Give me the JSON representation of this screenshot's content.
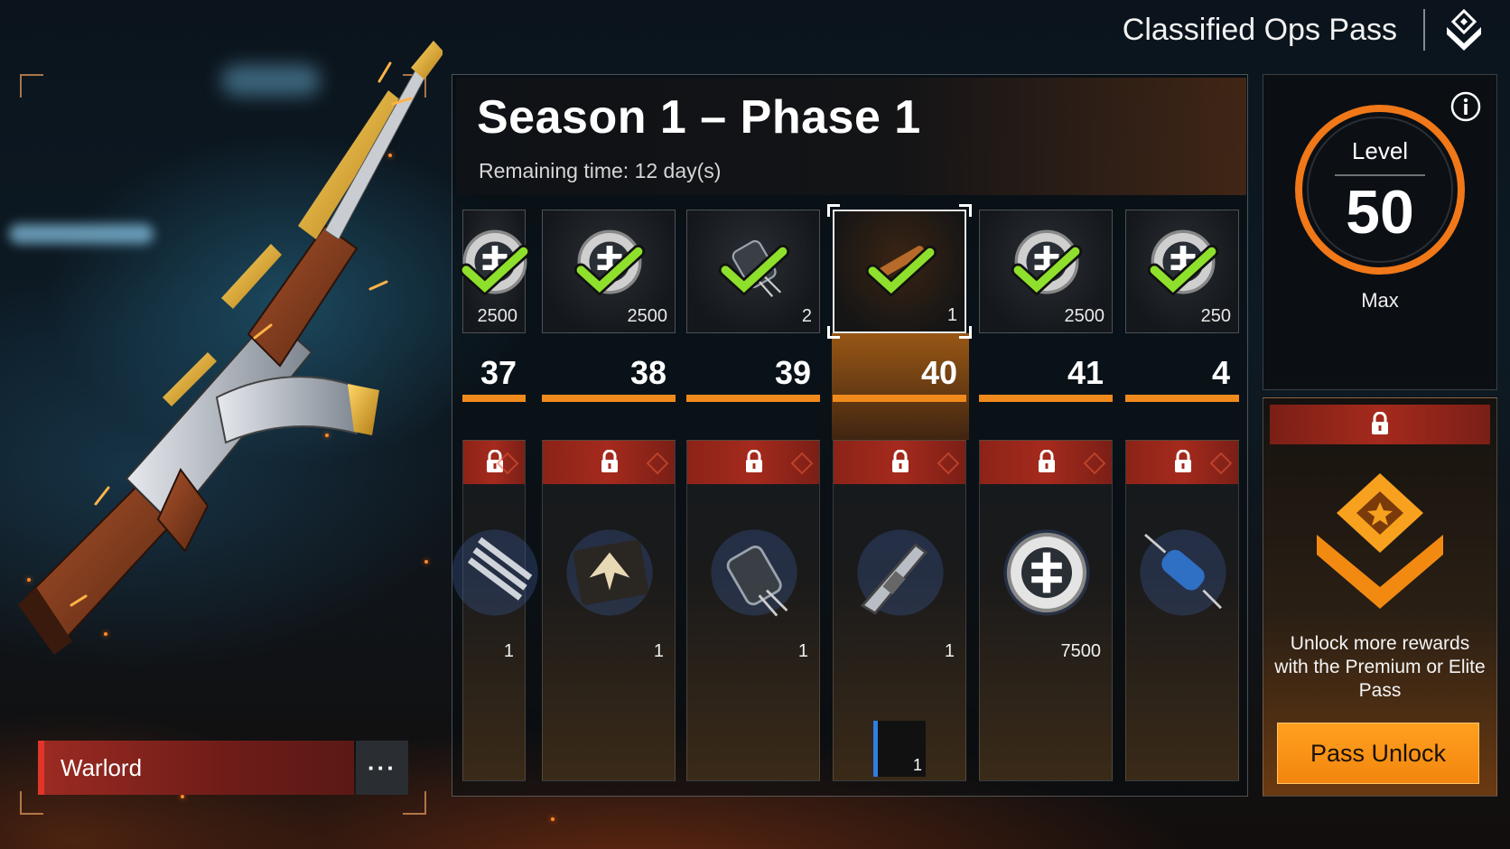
{
  "header": {
    "pass_title": "Classified Ops Pass",
    "pass_icon": "chevron-diamond-icon"
  },
  "season": {
    "title": "Season 1 – Phase 1",
    "remaining": "Remaining time: 12 day(s)"
  },
  "level": {
    "label": "Level",
    "value": "50",
    "max_label": "Max",
    "info_icon": "info-icon"
  },
  "weapon": {
    "name": "Warlord",
    "menu_label": "···"
  },
  "columns": [
    {
      "level": "37",
      "free": {
        "icon": "currency-coin-icon",
        "qty": "2500",
        "claimed": true
      },
      "premium": {
        "icon": "claw-weapon-icon",
        "qty": "1",
        "locked": true
      }
    },
    {
      "level": "38",
      "free": {
        "icon": "currency-coin-icon",
        "qty": "2500",
        "claimed": true
      },
      "premium": {
        "icon": "eagle-decal-icon",
        "qty": "1",
        "locked": true
      }
    },
    {
      "level": "39",
      "free": {
        "icon": "battery-component-icon",
        "qty": "2",
        "claimed": true
      },
      "premium": {
        "icon": "battery-component-icon",
        "qty": "1",
        "locked": true
      }
    },
    {
      "level": "40",
      "free": {
        "icon": "rifle-scope-icon",
        "qty": "1",
        "claimed": true,
        "current": true
      },
      "premium": {
        "icon": "assault-rifle-icon",
        "qty": "1",
        "locked": true,
        "bonus_qty": "1"
      }
    },
    {
      "level": "41",
      "free": {
        "icon": "currency-coin-icon",
        "qty": "2500",
        "claimed": true
      },
      "premium": {
        "icon": "currency-coin-icon",
        "qty": "7500",
        "locked": true
      }
    },
    {
      "level": "4",
      "free": {
        "icon": "currency-coin-icon",
        "qty": "250",
        "claimed": true
      },
      "premium": {
        "icon": "resistor-component-icon",
        "qty": "",
        "locked": true
      }
    }
  ],
  "unlock": {
    "text": "Unlock more rewards with the Premium or Elite Pass",
    "button": "Pass Unlock",
    "emblem_icon": "elite-rank-chevron-icon"
  },
  "colors": {
    "accent_orange": "#f08a1c",
    "lock_red": "#a52a1d",
    "check_green": "#8ee02c"
  }
}
